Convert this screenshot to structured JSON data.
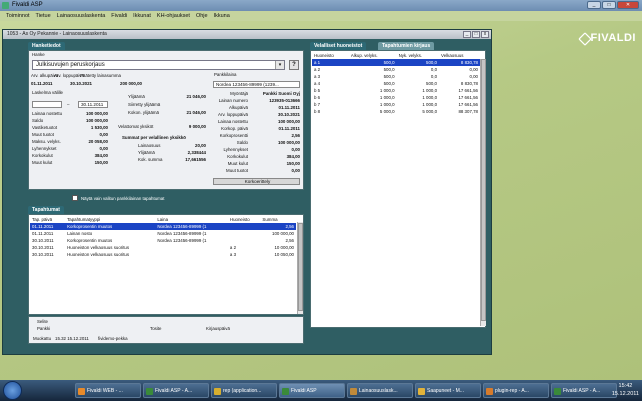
{
  "app": {
    "title": "Fivaldi ASP"
  },
  "menu": [
    "Toiminnot",
    "Tietue",
    "Lainaosuuslaskenta",
    "Fivaldi",
    "Ikkunat",
    "KH-ohjaukset",
    "Ohje",
    "Ikkuna"
  ],
  "logo": "FIVALDI",
  "document": {
    "title": "1053 - As Oy Pekannie - Lainaosuuslaskenta"
  },
  "hanke": {
    "tab": "Hanketiedot",
    "hanke_label": "Hanke",
    "hanke_value": "Julkisuvujen peruskorjaus",
    "alku_label": "Arv. alkupäivä",
    "loppu_label": "Arv. loppupäivä",
    "paatetty_label": "Päätetty lainasumma",
    "alku": "01.11.2011",
    "loppu": "30.10.2021",
    "paatetty": "200 000,00",
    "laskelma_label": "Laskelma välille",
    "date_from": "",
    "date_to": "30.11.2011",
    "left_labels": [
      "Lainaa nostettu",
      "Saldo",
      "Vastiketuotot",
      "Muut tuotot",
      "Maksu. velyks.",
      "Lyhennykset",
      "Korkokulut",
      "Muut kulut"
    ],
    "left_values": [
      "100 000,00",
      "100 000,00",
      "1 530,00",
      "0,00",
      "20 058,00",
      "0,00",
      "384,00",
      "150,00"
    ],
    "mid_labels": [
      "Ylijäämä",
      "Siirretty ylijäämä",
      "Kokon. ylijäämä"
    ],
    "mid_values": [
      "21 046,00",
      "",
      "21 046,00"
    ],
    "velattomat_label": "Velattomat yksiköt",
    "velattomat_value": "9 000,00",
    "summat_heading": "Summat per velallinen yksikkö",
    "summat_labels": [
      "Lainaosuus",
      "Ylijäämä",
      "Kok. summa"
    ],
    "summat_values": [
      "20,00",
      "2,338444",
      "17,661556"
    ],
    "pankki_label": "Pankkilaina",
    "pankki_value": "Nordea 123456-89999 (1239...",
    "right_labels": [
      "Myöntäjä",
      "Lainan numero",
      "Alkupäivä",
      "Arv. loppupäivä",
      "Lainaa nostettu",
      "Korkop. päivä",
      "Korkoprosentti",
      "Saldo",
      "Lyhennykset",
      "Korkokulut",
      "Muut kulut",
      "Muut tuotot"
    ],
    "right_values": [
      "Pankki Suomi Oyj",
      "123935-013666",
      "01.11.2011",
      "30.10.2021",
      "100 000,00",
      "01.11.2011",
      "2,56",
      "100 000,00",
      "0,00",
      "384,00",
      "150,00",
      "0,00"
    ],
    "korko_button": "Korkoerittely"
  },
  "checkbox_label": "Näytä vain valitun pankkilainan tapahtumat",
  "velalliset": {
    "tabs": [
      "Velalliset huoneistot",
      "Tapahtumien kirjaus"
    ],
    "headers": [
      "Huoneisto",
      "Alkup. velyks.",
      "Nyk. velyks.",
      "Velkaosuus"
    ],
    "rows": [
      [
        "a 1",
        "500,0",
        "500,0",
        "8 830,78"
      ],
      [
        "a 2",
        "500,0",
        "0,0",
        "0,00"
      ],
      [
        "a 3",
        "500,0",
        "0,0",
        "0,00"
      ],
      [
        "a 4",
        "500,0",
        "500,0",
        "8 830,78"
      ],
      [
        "b 5",
        "1 000,0",
        "1 000,0",
        "17 661,56"
      ],
      [
        "b 6",
        "1 000,0",
        "1 000,0",
        "17 661,56"
      ],
      [
        "b 7",
        "1 000,0",
        "1 000,0",
        "17 661,56"
      ],
      [
        "b 8",
        "5 000,0",
        "5 000,0",
        "88 307,78"
      ]
    ]
  },
  "tapahtumat": {
    "tab": "Tapahtumat",
    "headers": [
      "Tap. päivä",
      "Tapahtumatyyppi",
      "Laina",
      "Huoneisto",
      "Summa"
    ],
    "rows": [
      [
        "01.11.2011",
        "Korkoprosentin muutos",
        "Nordea 123456-89999 (1",
        "",
        "2,56"
      ],
      [
        "01.11.2011",
        "Lainan nosto",
        "Nordea 123456-89999 (1",
        "",
        "100 000,00"
      ],
      [
        "30.10.2011",
        "Korkoprosentin muutos",
        "Nordea 123456-89999 (1",
        "",
        "2,56"
      ],
      [
        "30.10.2011",
        "Huoneiston velkaosuus suoritus",
        "",
        "a 2",
        "10 000,00"
      ],
      [
        "30.10.2011",
        "Huoneiston velkaosuus suoritus",
        "",
        "a 3",
        "10 050,00"
      ]
    ],
    "detail_labels": [
      "Selite",
      "Pankki",
      "Tosite",
      "Kirjauspäivä"
    ],
    "muokattu_label": "Muokattu",
    "muokattu_value": "15.32 15.12.2011",
    "muokattu_user": "fividemo-pekka"
  },
  "taskbar": {
    "items": [
      "Fivaldi WEB - ...",
      "Fivaldi ASP - A...",
      "rep (application...",
      "Fivaldi ASP",
      "Lainaosuuslask...",
      "Saapuneet - M...",
      "plugin-rep - A...",
      "Fivaldi ASP - A..."
    ],
    "time": "15:42",
    "date": "15.12.2011"
  }
}
